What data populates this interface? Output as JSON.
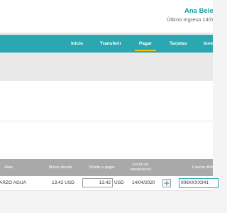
{
  "header": {
    "user_name": "Ana Bele",
    "last_login": "Último Ingreso 14/0"
  },
  "nav": {
    "items": [
      {
        "label": "Inicio",
        "active": false
      },
      {
        "label": "Transferir",
        "active": false
      },
      {
        "label": "Pagar",
        "active": true
      },
      {
        "label": "Tarjetas",
        "active": false
      },
      {
        "label": "Inve",
        "active": false
      }
    ],
    "active_underline_color": "#f0c419"
  },
  "colors": {
    "brand": "#2aa7b1",
    "table_header": "#a9a9a9"
  },
  "table": {
    "headers": {
      "alias": "Alias",
      "monto_deuda": "Monto deuda",
      "monto_pagar": "Monto a pagar",
      "fecha_line1": "Fecha de",
      "fecha_line2": "vencimiento",
      "cuenta": "Cuenta débi"
    },
    "rows": [
      {
        "alias": "ARZO AGUA",
        "monto_deuda": "13.42 USD",
        "monto_pagar_value": "13.42",
        "monto_pagar_currency": "USD",
        "fecha": "14/04/2020",
        "add_icon": "plus-icon",
        "cuenta": "006XXXX941"
      }
    ]
  }
}
